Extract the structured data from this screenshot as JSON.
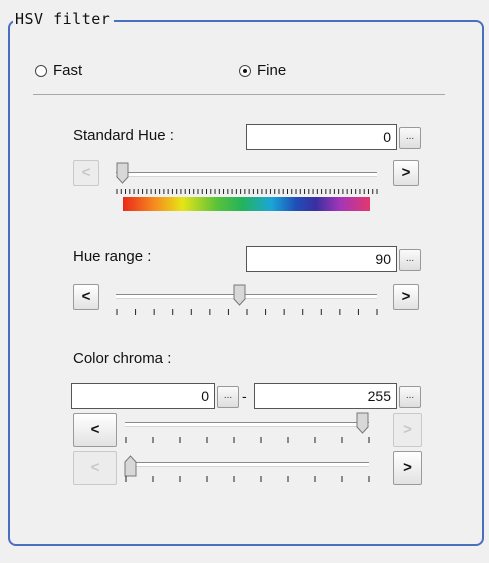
{
  "group": {
    "title": "HSV filter"
  },
  "mode": {
    "fast_label": "Fast",
    "fine_label": "Fine",
    "selected": "Fine"
  },
  "standard_hue": {
    "label": "Standard Hue :",
    "value": "0",
    "ellipsis": "...",
    "dec_label": "<",
    "inc_label": ">",
    "dec_enabled": false,
    "inc_enabled": true,
    "slider_fraction": 0.0
  },
  "hue_range": {
    "label": "Hue range :",
    "value": "90",
    "ellipsis": "...",
    "dec_label": "<",
    "inc_label": ">",
    "slider_fraction": 0.5
  },
  "color_chroma": {
    "label": "Color chroma :",
    "min_value": "0",
    "max_value": "255",
    "separator": "-",
    "ellipsis": "...",
    "dec_label": "<",
    "inc_label": ">",
    "upper_slider_fraction": 1.0,
    "lower_slider_fraction": 0.0,
    "upper_inc_enabled": false,
    "lower_dec_enabled": false
  },
  "colors": {
    "group_border": "#4a6ec0",
    "panel_bg": "#f0f0f0"
  }
}
